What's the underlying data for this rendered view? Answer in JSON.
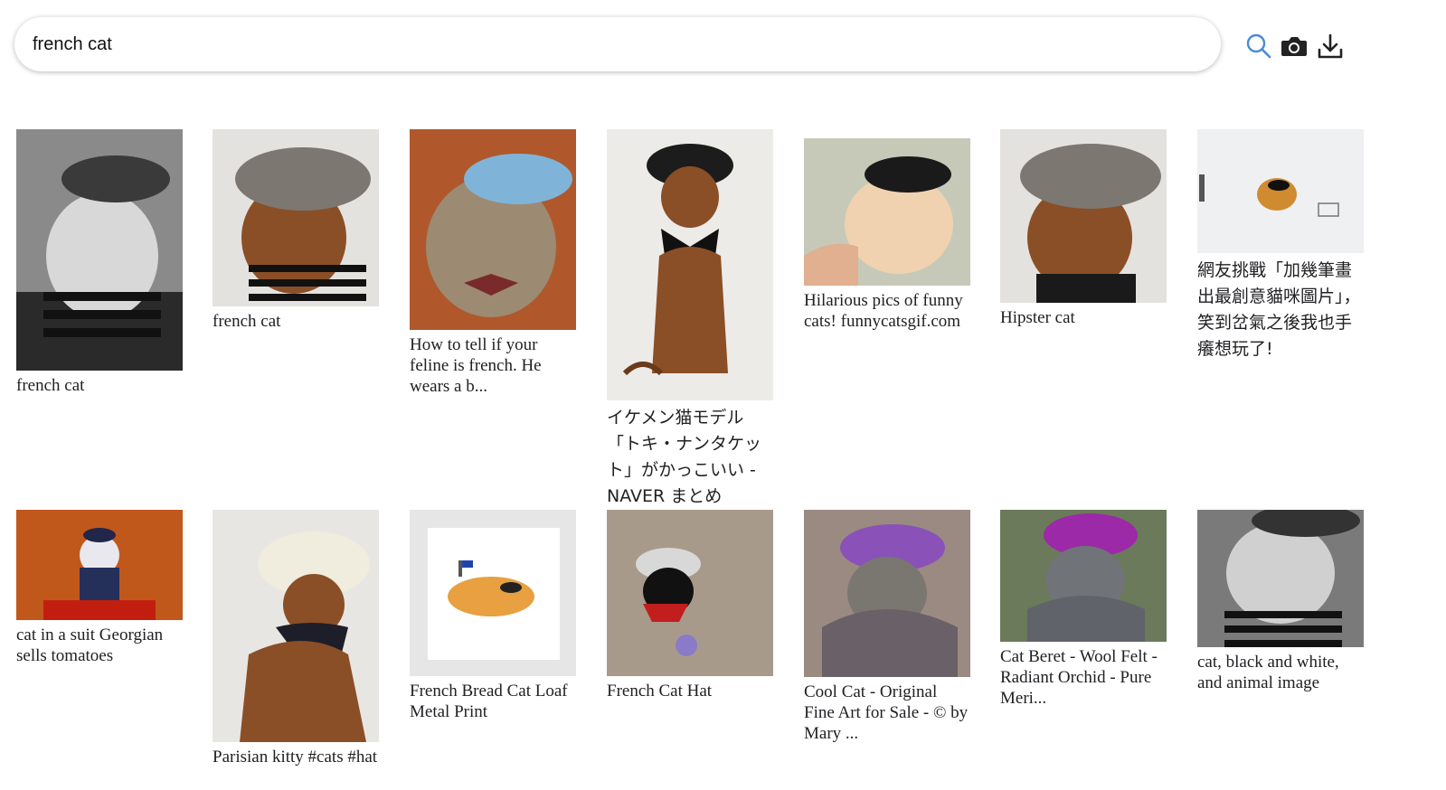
{
  "search": {
    "value": "french cat",
    "placeholder": ""
  },
  "toolbar": {
    "search_icon": "magnifier-icon",
    "camera_icon": "camera-icon",
    "download_icon": "download-icon"
  },
  "colors": {
    "accent": "#4a8bd4",
    "text": "#202124"
  },
  "results": [
    {
      "caption": "french cat"
    },
    {
      "caption": "french cat"
    },
    {
      "caption": "How to tell if your feline is french. He wears a b..."
    },
    {
      "caption": "イケメン猫モデル「トキ・ナンタケット」がかっこいい - NAVER まとめ"
    },
    {
      "caption": "Hilarious pics of funny cats! funnycatsgif.com"
    },
    {
      "caption": "Hipster cat"
    },
    {
      "caption": "網友挑戰「加幾筆畫出最創意貓咪圖片」，笑到岔氣之後我也手癢想玩了!"
    },
    {
      "caption": "cat in a suit Georgian sells tomatoes"
    },
    {
      "caption": "Parisian kitty #cats #hat"
    },
    {
      "caption": "French Bread Cat Loaf Metal Print"
    },
    {
      "caption": "French Cat Hat"
    },
    {
      "caption": "Cool Cat - Original Fine Art for Sale - © by Mary ..."
    },
    {
      "caption": "Cat Beret - Wool Felt - Radiant Orchid - Pure Meri..."
    },
    {
      "caption": "cat, black and white, and animal image"
    }
  ]
}
